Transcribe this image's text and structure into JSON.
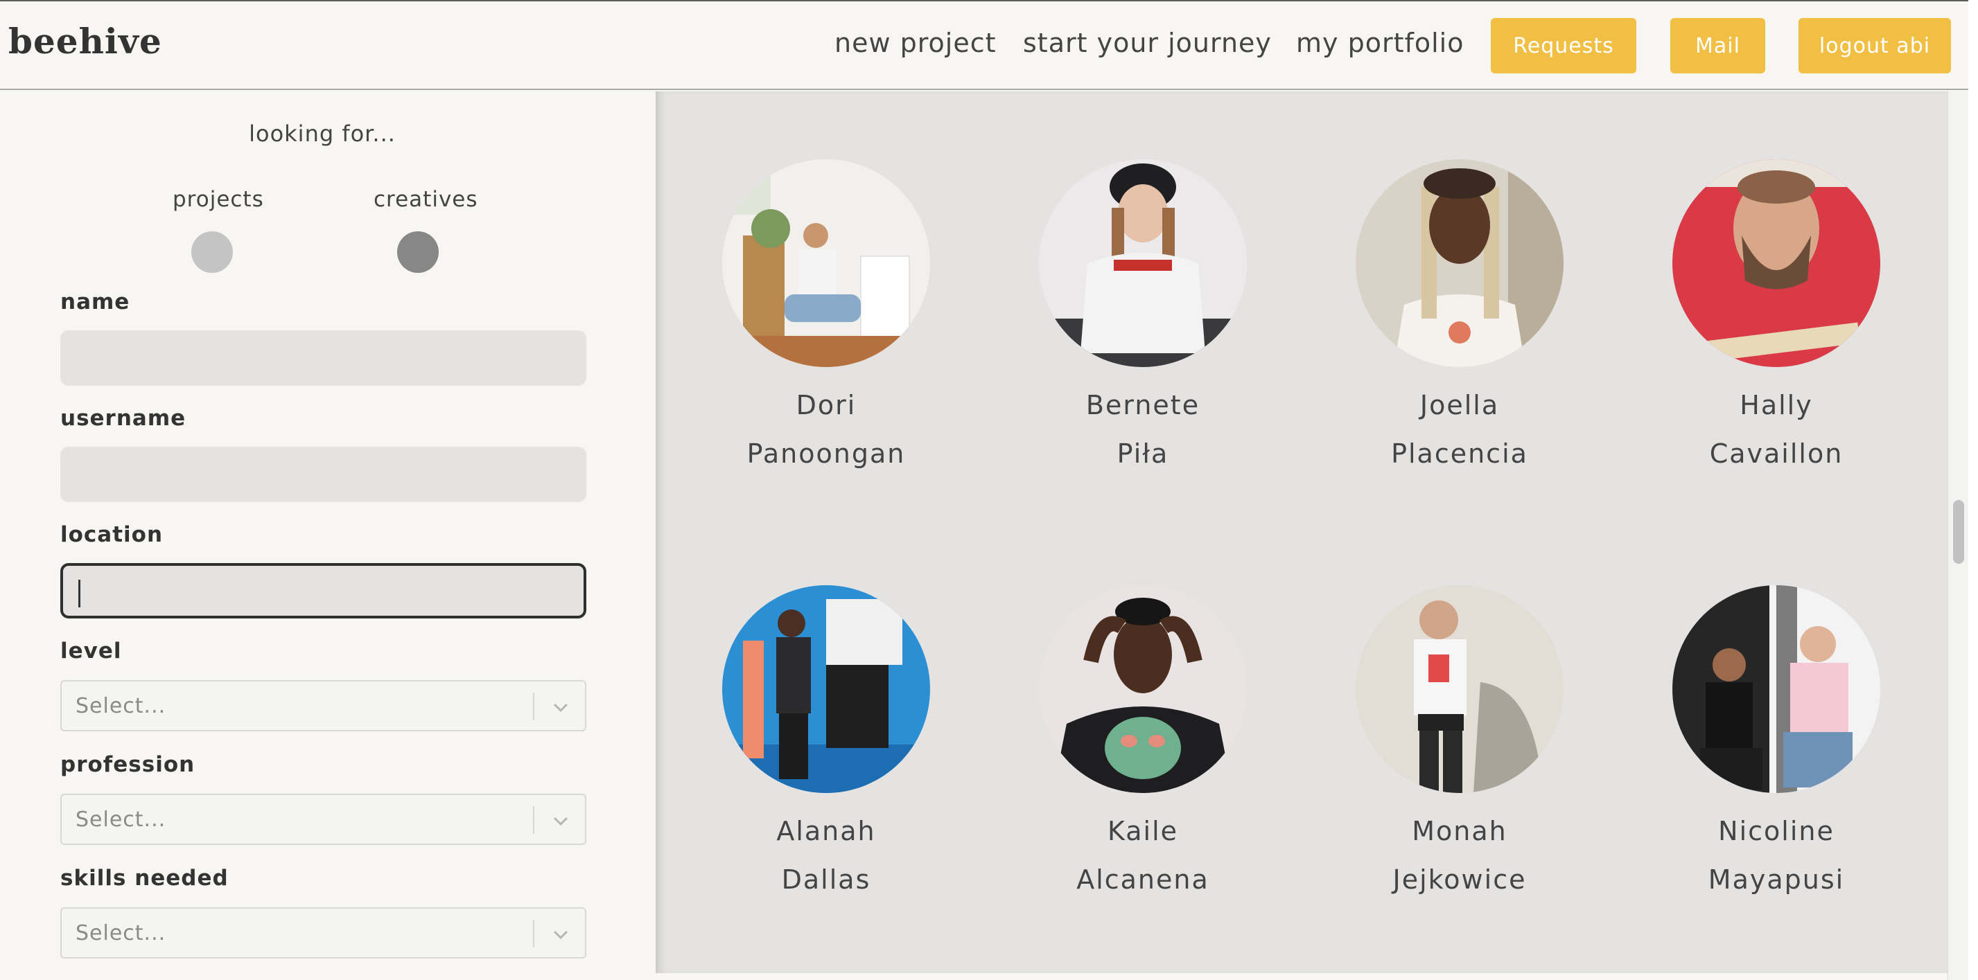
{
  "header": {
    "logo": "beehive",
    "links": [
      "new project",
      "start your journey",
      "my portfolio"
    ],
    "buttons": [
      "Requests",
      "Mail",
      "logout abi"
    ]
  },
  "sidebar": {
    "title": "looking for...",
    "toggle": {
      "options": [
        "projects",
        "creatives"
      ],
      "selected": "creatives"
    },
    "fields": {
      "name": {
        "label": "name",
        "value": ""
      },
      "username": {
        "label": "username",
        "value": ""
      },
      "location": {
        "label": "location",
        "value": ""
      }
    },
    "selects": {
      "level": {
        "label": "level",
        "placeholder": "Select..."
      },
      "profession": {
        "label": "profession",
        "placeholder": "Select..."
      },
      "skills": {
        "label": "skills needed",
        "placeholder": "Select..."
      }
    }
  },
  "creatives": [
    {
      "first": "Dori",
      "last": "Panoongan"
    },
    {
      "first": "Bernete",
      "last": "Piła"
    },
    {
      "first": "Joella",
      "last": "Placencia"
    },
    {
      "first": "Hally",
      "last": "Cavaillon"
    },
    {
      "first": "Alanah",
      "last": "Dallas"
    },
    {
      "first": "Kaile",
      "last": "Alcanena"
    },
    {
      "first": "Monah",
      "last": "Jejkowice"
    },
    {
      "first": "Nicoline",
      "last": "Mayapusi"
    }
  ],
  "colors": {
    "accent": "#f2bf45",
    "toggle_off": "#c4c4c4",
    "toggle_on": "#878787"
  }
}
